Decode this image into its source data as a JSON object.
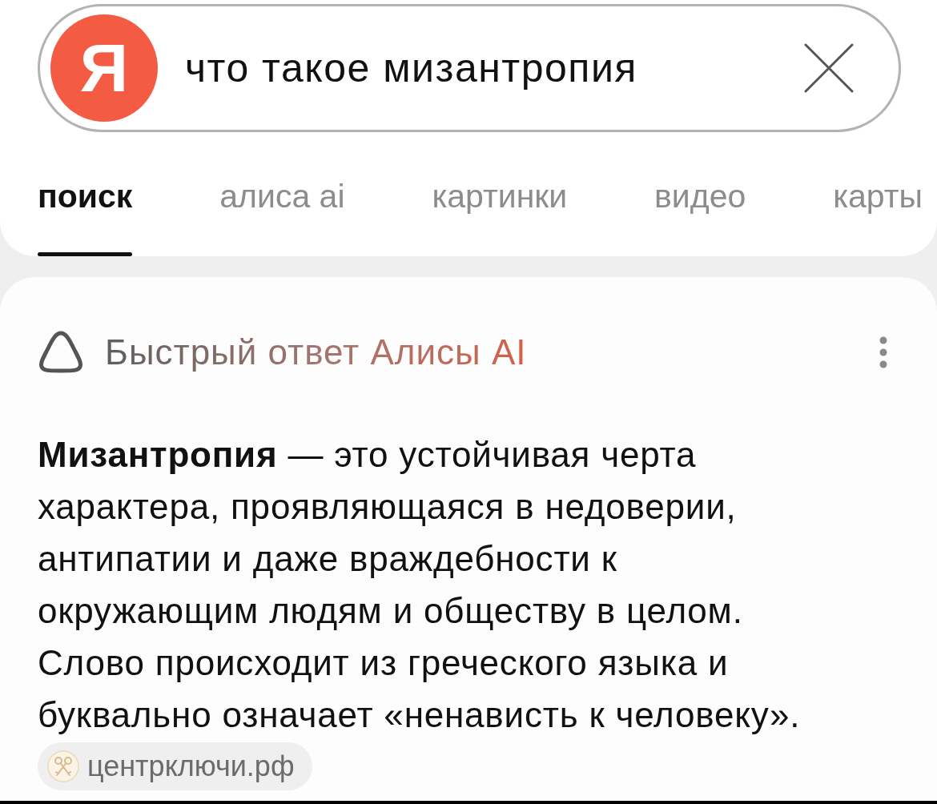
{
  "search": {
    "logo": "Я",
    "query": "что такое мизантропия"
  },
  "tabs": [
    {
      "label": "поиск",
      "selected": true
    },
    {
      "label": "алиса ai",
      "selected": false
    },
    {
      "label": "картинки",
      "selected": false
    },
    {
      "label": "видео",
      "selected": false
    },
    {
      "label": "карты",
      "selected": false
    }
  ],
  "answer_card": {
    "title": "Быстрый ответ Алисы AI",
    "text": "**Мизантропия** — это устойчивая черта характера, проявляющаяся в недоверии, антипатии и даже враждебности к окружающим людям и обществу в целом. Слово происходит из греческого языка и буквально означает «ненависть к человеку».",
    "source": {
      "label": "центрключи.рф"
    }
  }
}
